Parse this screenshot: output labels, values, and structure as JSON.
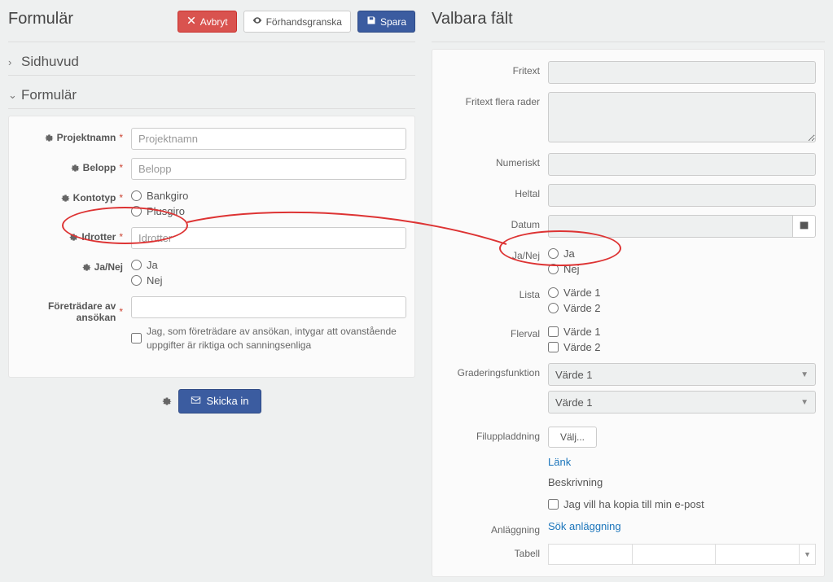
{
  "left": {
    "title": "Formulär",
    "abort": "Avbryt",
    "preview": "Förhandsgranska",
    "save": "Spara",
    "sections": {
      "sidhuvud": "Sidhuvud",
      "formular": "Formulär"
    },
    "fields": {
      "projektnamn": {
        "label": "Projektnamn",
        "placeholder": "Projektnamn"
      },
      "belopp": {
        "label": "Belopp",
        "placeholder": "Belopp"
      },
      "kontotyp": {
        "label": "Kontotyp",
        "bankgiro": "Bankgiro",
        "plusgiro": "Plusgiro"
      },
      "idrotter": {
        "label": "Idrotter",
        "placeholder": "Idrotter"
      },
      "janej": {
        "label": "Ja/Nej",
        "ja": "Ja",
        "nej": "Nej"
      },
      "foretradare": {
        "label": "Företrädare av ansökan",
        "helper": "Jag, som företrädare av ansökan, intygar att ovanstående uppgifter är riktiga och sanningsenliga"
      }
    },
    "submit": "Skicka in"
  },
  "right": {
    "title": "Valbara fält",
    "fields": {
      "fritext": "Fritext",
      "fritext_multi": "Fritext flera rader",
      "numeriskt": "Numeriskt",
      "heltal": "Heltal",
      "datum": "Datum",
      "janej": {
        "label": "Ja/Nej",
        "ja": "Ja",
        "nej": "Nej"
      },
      "lista": {
        "label": "Lista",
        "v1": "Värde 1",
        "v2": "Värde 2"
      },
      "flerval": {
        "label": "Flerval",
        "v1": "Värde 1",
        "v2": "Värde 2"
      },
      "gradering": {
        "label": "Graderingsfunktion",
        "value": "Värde 1"
      },
      "filuppladdning": {
        "label": "Filuppladdning",
        "button": "Välj..."
      },
      "lank": "Länk",
      "beskrivning": "Beskrivning",
      "kopia": "Jag vill ha kopia till min e-post",
      "anlaggning": {
        "label": "Anläggning",
        "link": "Sök anläggning"
      },
      "tabell": "Tabell"
    }
  }
}
